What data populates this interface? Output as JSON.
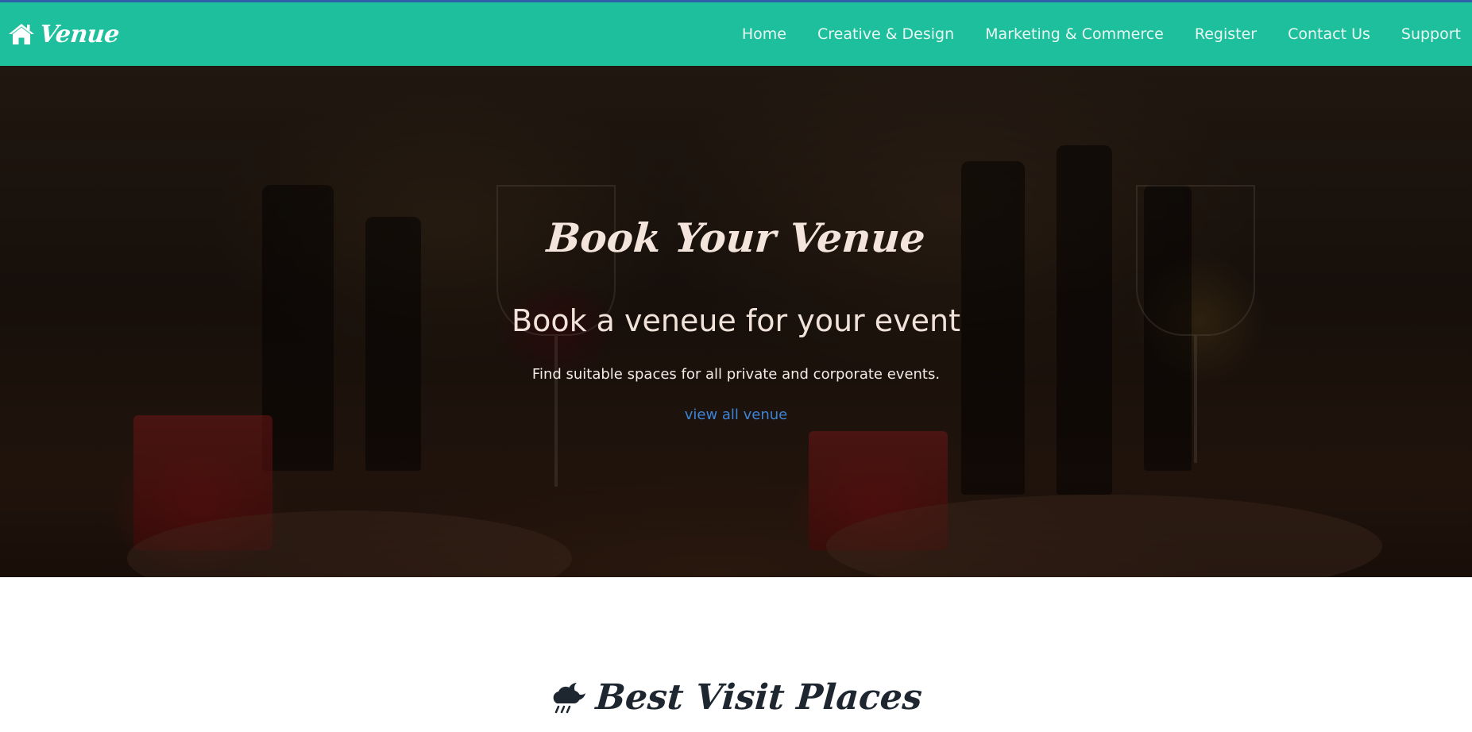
{
  "navbar": {
    "brand": {
      "icon": "home-icon",
      "name": "Venue"
    },
    "links": [
      {
        "label": "Home"
      },
      {
        "label": "Creative & Design"
      },
      {
        "label": "Marketing & Commerce"
      },
      {
        "label": "Register"
      },
      {
        "label": "Contact Us"
      },
      {
        "label": "Support"
      }
    ],
    "background_color": "#1dbf9c",
    "top_strip_color": "#2f5fa8"
  },
  "hero": {
    "title": "Book Your Venue",
    "subtitle": "Book a veneue for your event",
    "text": "Find suitable spaces for all private and corporate events.",
    "link_label": "view all venue",
    "link_color": "#3c84d6"
  },
  "section": {
    "icon": "cloud-moon-rain-icon",
    "heading": "Best Visit Places"
  }
}
